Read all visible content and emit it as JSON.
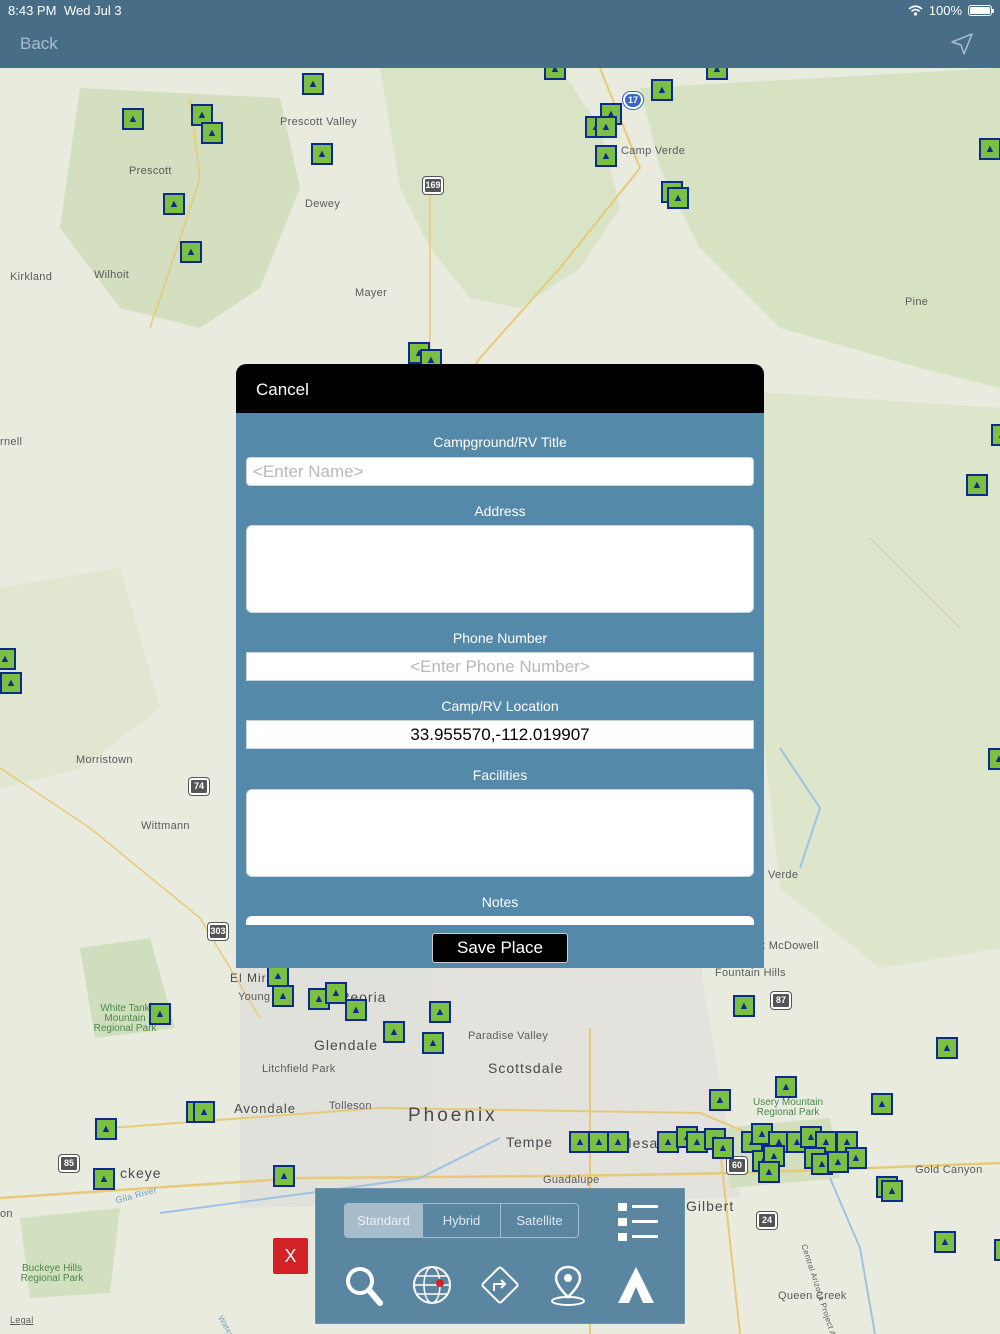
{
  "status_bar": {
    "time": "8:43 PM",
    "date": "Wed Jul 3",
    "battery": "100%",
    "icons": [
      "wifi-icon",
      "battery-icon"
    ]
  },
  "nav": {
    "back_label": "Back",
    "right_icon": "location-arrow-icon"
  },
  "map": {
    "place_labels": [
      "Prescott Valley",
      "Prescott",
      "Dewey",
      "Camp Verde",
      "Kirkland",
      "Wilhoit",
      "Mayer",
      "Pine",
      "rnell",
      "Morristown",
      "Wittmann",
      "El Mirage",
      "Young",
      "Peoria",
      "Glendale",
      "Paradise Valley",
      "Scottsdale",
      "Litchfield Park",
      "Avondale",
      "Tolleson",
      "Phoenix",
      "Tempe",
      "Mesa",
      "Guadalupe",
      "Gilbert",
      "ckeye",
      "Gila River",
      "Fountain Hills",
      "t McDowell",
      "Verde",
      "Usery Mountain Regional Park",
      "Gold Canyon",
      "Queen Creek",
      "on",
      "Central Arizona Project Aqueduct",
      "Waterm",
      "Legal"
    ],
    "park_labels": [
      "White Tank Mountain Regional Park",
      "Buckeye Hills Regional Park"
    ],
    "highway_shields": [
      "17",
      "169",
      "74",
      "303",
      "87",
      "85",
      "60",
      "24"
    ],
    "marker_icon": "campground-tent-icon"
  },
  "modal": {
    "cancel_label": "Cancel",
    "title_label": "Campground/RV Title",
    "title_placeholder": "<Enter Name>",
    "address_label": "Address",
    "phone_label": "Phone Number",
    "phone_placeholder": "<Enter Phone Number>",
    "location_label": "Camp/RV Location",
    "location_value": "33.955570,-112.019907",
    "facilities_label": "Facilities",
    "notes_label": "Notes",
    "save_label": "Save Place"
  },
  "close_button": "X",
  "toolbar": {
    "map_types": [
      "Standard",
      "Hybrid",
      "Satellite"
    ],
    "selected_map_type": "Standard",
    "icons": [
      "list-icon",
      "search-icon",
      "globe-icon",
      "directions-icon",
      "map-pin-icon",
      "tent-icon"
    ]
  },
  "colors": {
    "nav": "#486d87",
    "modal": "#5589a9",
    "toolbar": "#5a86a2",
    "marker_border": "#0e2a8c",
    "marker_fill": "#7bc043",
    "close": "#d32226"
  }
}
